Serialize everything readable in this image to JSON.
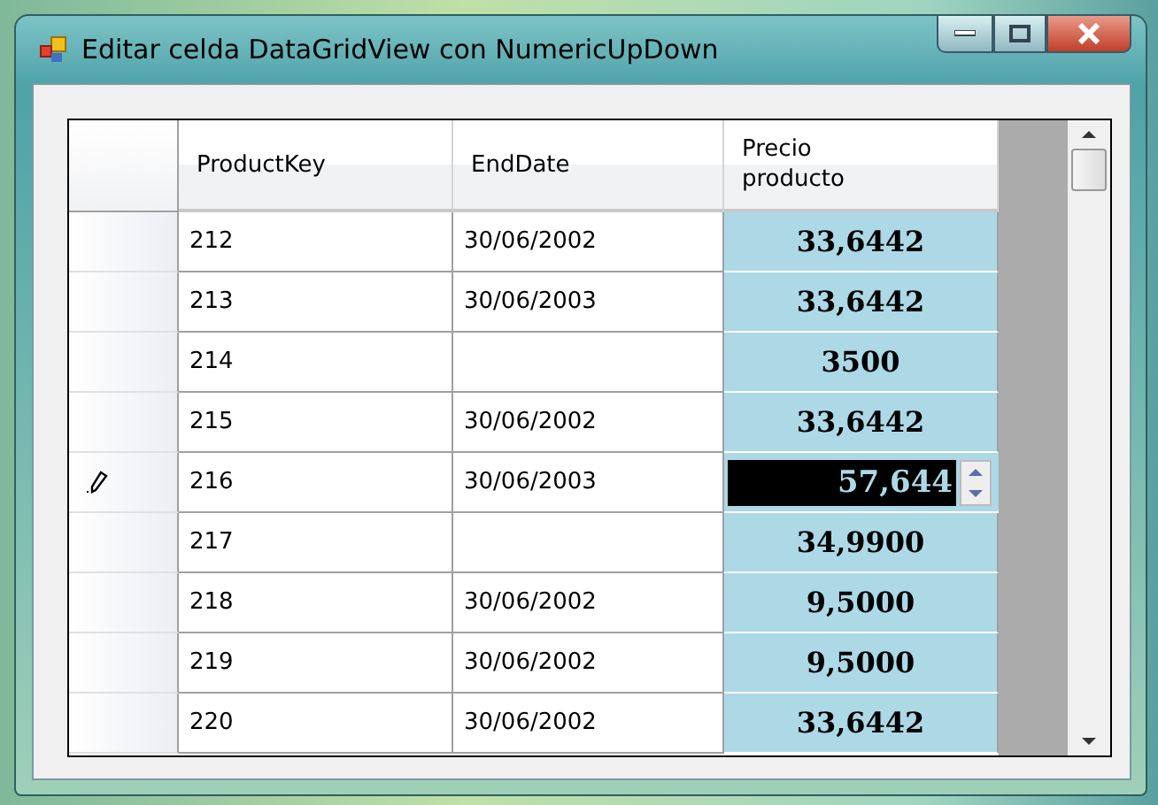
{
  "window": {
    "title": "Editar celda DataGridView con NumericUpDown"
  },
  "grid": {
    "columns": [
      "ProductKey",
      "EndDate",
      "Precio producto"
    ],
    "rows": [
      {
        "key": "212",
        "end_date": "30/06/2002",
        "price": "33,6442",
        "editing": false
      },
      {
        "key": "213",
        "end_date": "30/06/2003",
        "price": "33,6442",
        "editing": false
      },
      {
        "key": "214",
        "end_date": "",
        "price": "3500",
        "editing": false
      },
      {
        "key": "215",
        "end_date": "30/06/2002",
        "price": "33,6442",
        "editing": false
      },
      {
        "key": "216",
        "end_date": "30/06/2003",
        "price": "57,644",
        "editing": true
      },
      {
        "key": "217",
        "end_date": "",
        "price": "34,9900",
        "editing": false
      },
      {
        "key": "218",
        "end_date": "30/06/2002",
        "price": "9,5000",
        "editing": false
      },
      {
        "key": "219",
        "end_date": "30/06/2002",
        "price": "9,5000",
        "editing": false
      },
      {
        "key": "220",
        "end_date": "30/06/2002",
        "price": "33,6442",
        "editing": false
      }
    ]
  }
}
